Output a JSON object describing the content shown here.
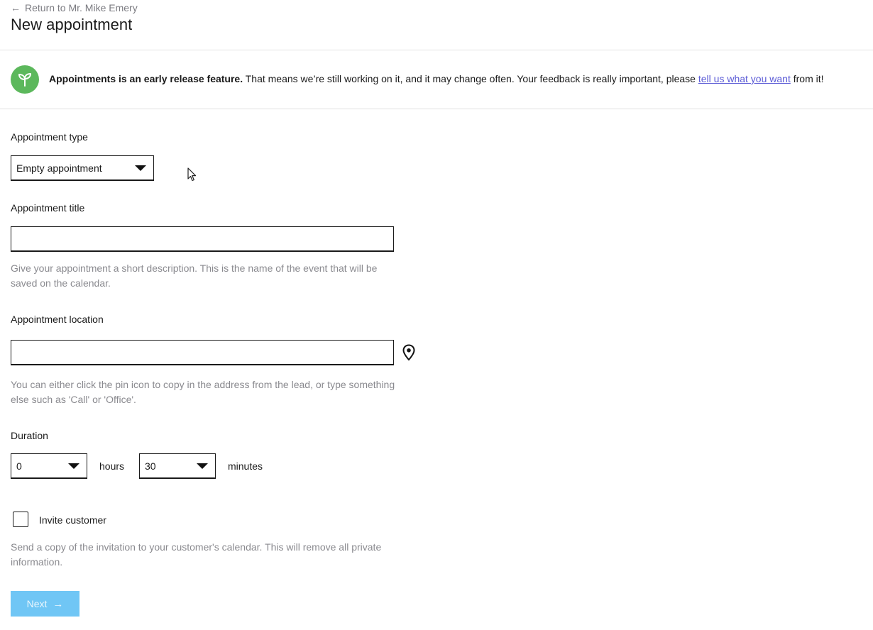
{
  "header": {
    "back_arrow": "←",
    "back_link": "Return to Mr. Mike Emery",
    "title": "New appointment"
  },
  "banner": {
    "icon": "sprout-icon",
    "icon_color": "#5cb85c",
    "bold_text": "Appointments is an early release feature.",
    "text": " That means we’re still working on it, and it may change often. Your feedback is really important, please ",
    "link_text": "tell us what you want",
    "suffix": " from it!"
  },
  "form": {
    "appointment_type": {
      "label": "Appointment type",
      "value": "Empty appointment"
    },
    "appointment_title": {
      "label": "Appointment title",
      "value": "",
      "help": "Give your appointment a short description. This is the name of the event that will be saved on the calendar."
    },
    "appointment_location": {
      "label": "Appointment location",
      "value": "",
      "pin_icon": "map-pin-icon",
      "help": "You can either click the pin icon to copy in the address from the lead, or type something else such as 'Call' or 'Office'."
    },
    "duration": {
      "label": "Duration",
      "hours_value": "0",
      "hours_label": "hours",
      "minutes_value": "30",
      "minutes_label": "minutes"
    },
    "invite_customer": {
      "label": "Invite customer",
      "checked": false,
      "help": "Send a copy of the invitation to your customer's calendar. This will remove all private information."
    },
    "next_button": {
      "label": "Next",
      "arrow": "→",
      "color": "#70c6f5"
    }
  }
}
